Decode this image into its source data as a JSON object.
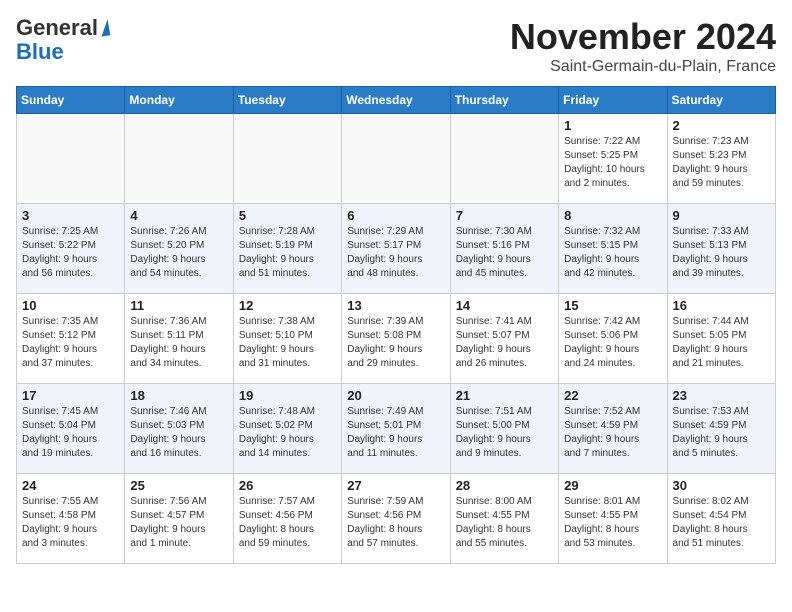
{
  "header": {
    "logo_general": "General",
    "logo_blue": "Blue",
    "month_title": "November 2024",
    "location": "Saint-Germain-du-Plain, France"
  },
  "days_of_week": [
    "Sunday",
    "Monday",
    "Tuesday",
    "Wednesday",
    "Thursday",
    "Friday",
    "Saturday"
  ],
  "weeks": [
    [
      {
        "num": "",
        "info": ""
      },
      {
        "num": "",
        "info": ""
      },
      {
        "num": "",
        "info": ""
      },
      {
        "num": "",
        "info": ""
      },
      {
        "num": "",
        "info": ""
      },
      {
        "num": "1",
        "info": "Sunrise: 7:22 AM\nSunset: 5:25 PM\nDaylight: 10 hours\nand 2 minutes."
      },
      {
        "num": "2",
        "info": "Sunrise: 7:23 AM\nSunset: 5:23 PM\nDaylight: 9 hours\nand 59 minutes."
      }
    ],
    [
      {
        "num": "3",
        "info": "Sunrise: 7:25 AM\nSunset: 5:22 PM\nDaylight: 9 hours\nand 56 minutes."
      },
      {
        "num": "4",
        "info": "Sunrise: 7:26 AM\nSunset: 5:20 PM\nDaylight: 9 hours\nand 54 minutes."
      },
      {
        "num": "5",
        "info": "Sunrise: 7:28 AM\nSunset: 5:19 PM\nDaylight: 9 hours\nand 51 minutes."
      },
      {
        "num": "6",
        "info": "Sunrise: 7:29 AM\nSunset: 5:17 PM\nDaylight: 9 hours\nand 48 minutes."
      },
      {
        "num": "7",
        "info": "Sunrise: 7:30 AM\nSunset: 5:16 PM\nDaylight: 9 hours\nand 45 minutes."
      },
      {
        "num": "8",
        "info": "Sunrise: 7:32 AM\nSunset: 5:15 PM\nDaylight: 9 hours\nand 42 minutes."
      },
      {
        "num": "9",
        "info": "Sunrise: 7:33 AM\nSunset: 5:13 PM\nDaylight: 9 hours\nand 39 minutes."
      }
    ],
    [
      {
        "num": "10",
        "info": "Sunrise: 7:35 AM\nSunset: 5:12 PM\nDaylight: 9 hours\nand 37 minutes."
      },
      {
        "num": "11",
        "info": "Sunrise: 7:36 AM\nSunset: 5:11 PM\nDaylight: 9 hours\nand 34 minutes."
      },
      {
        "num": "12",
        "info": "Sunrise: 7:38 AM\nSunset: 5:10 PM\nDaylight: 9 hours\nand 31 minutes."
      },
      {
        "num": "13",
        "info": "Sunrise: 7:39 AM\nSunset: 5:08 PM\nDaylight: 9 hours\nand 29 minutes."
      },
      {
        "num": "14",
        "info": "Sunrise: 7:41 AM\nSunset: 5:07 PM\nDaylight: 9 hours\nand 26 minutes."
      },
      {
        "num": "15",
        "info": "Sunrise: 7:42 AM\nSunset: 5:06 PM\nDaylight: 9 hours\nand 24 minutes."
      },
      {
        "num": "16",
        "info": "Sunrise: 7:44 AM\nSunset: 5:05 PM\nDaylight: 9 hours\nand 21 minutes."
      }
    ],
    [
      {
        "num": "17",
        "info": "Sunrise: 7:45 AM\nSunset: 5:04 PM\nDaylight: 9 hours\nand 19 minutes."
      },
      {
        "num": "18",
        "info": "Sunrise: 7:46 AM\nSunset: 5:03 PM\nDaylight: 9 hours\nand 16 minutes."
      },
      {
        "num": "19",
        "info": "Sunrise: 7:48 AM\nSunset: 5:02 PM\nDaylight: 9 hours\nand 14 minutes."
      },
      {
        "num": "20",
        "info": "Sunrise: 7:49 AM\nSunset: 5:01 PM\nDaylight: 9 hours\nand 11 minutes."
      },
      {
        "num": "21",
        "info": "Sunrise: 7:51 AM\nSunset: 5:00 PM\nDaylight: 9 hours\nand 9 minutes."
      },
      {
        "num": "22",
        "info": "Sunrise: 7:52 AM\nSunset: 4:59 PM\nDaylight: 9 hours\nand 7 minutes."
      },
      {
        "num": "23",
        "info": "Sunrise: 7:53 AM\nSunset: 4:59 PM\nDaylight: 9 hours\nand 5 minutes."
      }
    ],
    [
      {
        "num": "24",
        "info": "Sunrise: 7:55 AM\nSunset: 4:58 PM\nDaylight: 9 hours\nand 3 minutes."
      },
      {
        "num": "25",
        "info": "Sunrise: 7:56 AM\nSunset: 4:57 PM\nDaylight: 9 hours\nand 1 minute."
      },
      {
        "num": "26",
        "info": "Sunrise: 7:57 AM\nSunset: 4:56 PM\nDaylight: 8 hours\nand 59 minutes."
      },
      {
        "num": "27",
        "info": "Sunrise: 7:59 AM\nSunset: 4:56 PM\nDaylight: 8 hours\nand 57 minutes."
      },
      {
        "num": "28",
        "info": "Sunrise: 8:00 AM\nSunset: 4:55 PM\nDaylight: 8 hours\nand 55 minutes."
      },
      {
        "num": "29",
        "info": "Sunrise: 8:01 AM\nSunset: 4:55 PM\nDaylight: 8 hours\nand 53 minutes."
      },
      {
        "num": "30",
        "info": "Sunrise: 8:02 AM\nSunset: 4:54 PM\nDaylight: 8 hours\nand 51 minutes."
      }
    ]
  ]
}
